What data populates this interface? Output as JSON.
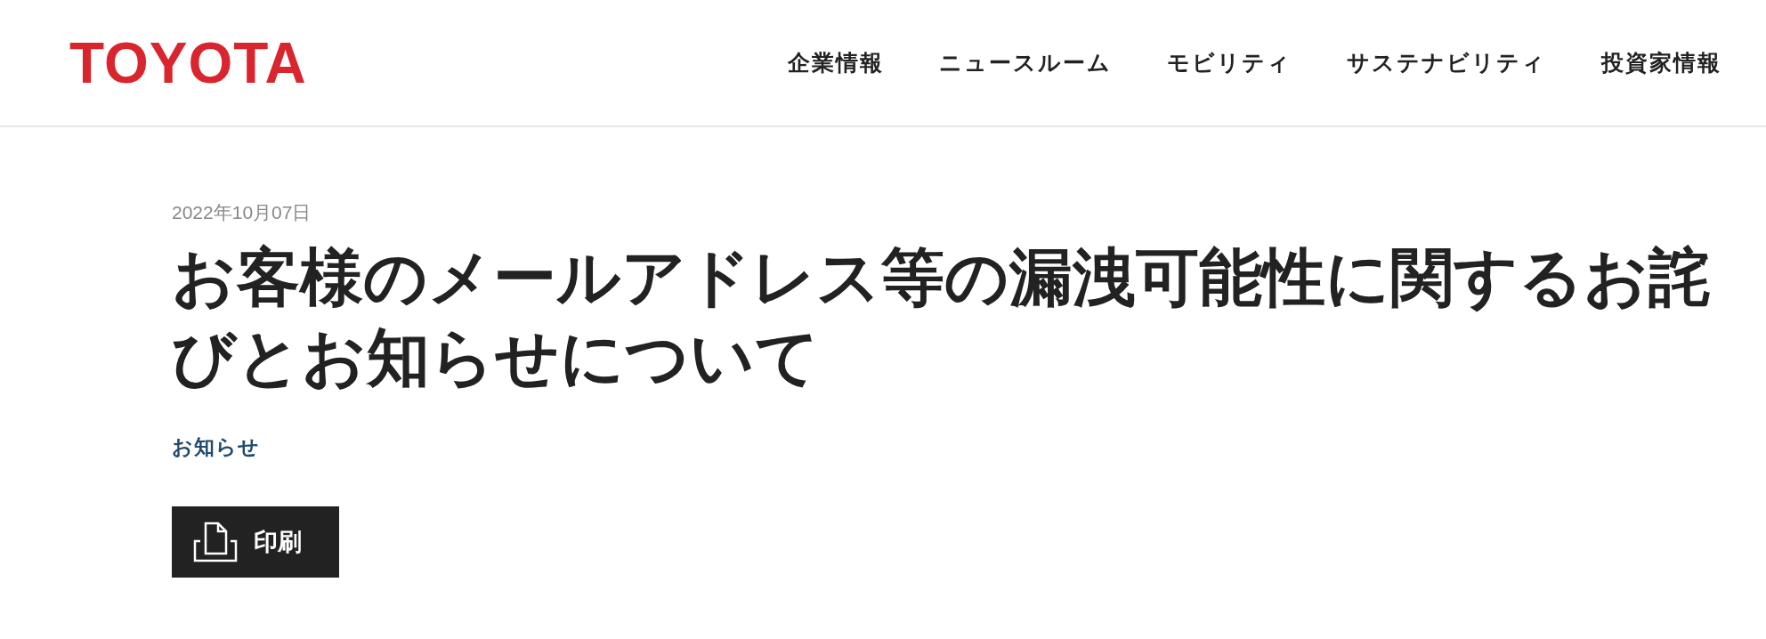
{
  "header": {
    "logo": "TOYOTA",
    "nav": [
      {
        "label": "企業情報"
      },
      {
        "label": "ニュースルーム"
      },
      {
        "label": "モビリティ"
      },
      {
        "label": "サステナビリティ"
      },
      {
        "label": "投資家情報"
      }
    ]
  },
  "article": {
    "date": "2022年10月07日",
    "title": "お客様のメールアドレス等の漏洩可能性に関するお詫びとお知らせについて",
    "category": "お知らせ",
    "print_button": {
      "label": "印刷"
    }
  }
}
